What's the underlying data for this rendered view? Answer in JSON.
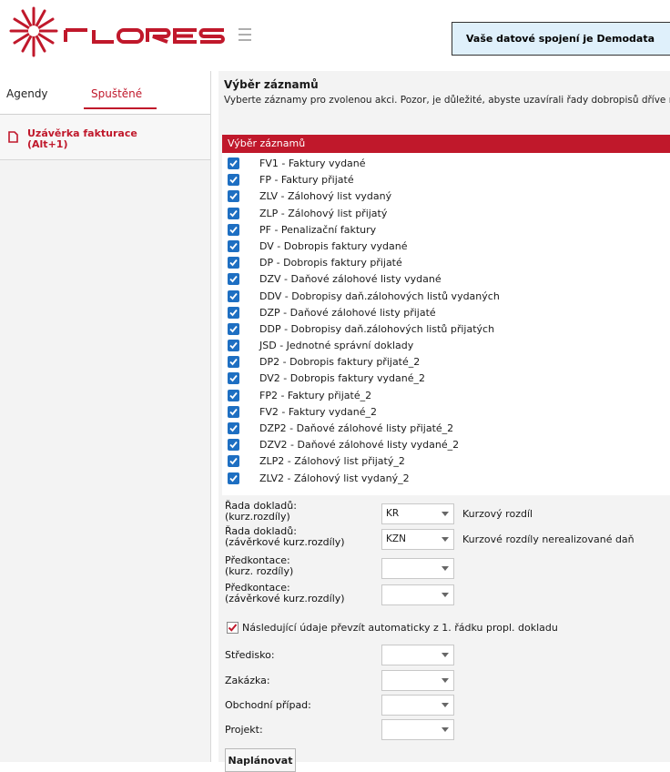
{
  "header": {
    "connection_text": "Vaše datové spojení je Demodata"
  },
  "colors": {
    "accent": "#c0182b",
    "checkbox": "#1e6fc2"
  },
  "sidebar": {
    "tabs": [
      {
        "label": "Agendy"
      },
      {
        "label": "Spuštěné",
        "active": true
      }
    ],
    "items": [
      {
        "label_line1": "Uzávěrka fakturace",
        "label_line2": "(Alt+1)",
        "icon": "document-icon"
      }
    ]
  },
  "main": {
    "title": "Výběr záznamů",
    "description": "Vyberte záznamy pro zvolenou akci. Pozor, je důležité, abyste uzavírali řady dobropisů dříve ne",
    "list_header": "Výběr záznamů",
    "records": [
      {
        "label": "FV1 - Faktury vydané",
        "checked": true
      },
      {
        "label": "FP - Faktury přijaté",
        "checked": true
      },
      {
        "label": "ZLV - Zálohový list vydaný",
        "checked": true
      },
      {
        "label": "ZLP - Zálohový list přijatý",
        "checked": true
      },
      {
        "label": "PF - Penalizační faktury",
        "checked": true
      },
      {
        "label": "DV - Dobropis faktury vydané",
        "checked": true
      },
      {
        "label": "DP - Dobropis faktury přijaté",
        "checked": true
      },
      {
        "label": "DZV - Daňové zálohové listy vydané",
        "checked": true
      },
      {
        "label": "DDV - Dobropisy daň.zálohových listů vydaných",
        "checked": true
      },
      {
        "label": "DZP - Daňové zálohové listy přijaté",
        "checked": true
      },
      {
        "label": "DDP - Dobropisy daň.zálohových listů přijatých",
        "checked": true
      },
      {
        "label": "JSD - Jednotné správní doklady",
        "checked": true
      },
      {
        "label": "DP2 - Dobropis faktury přijaté_2",
        "checked": true
      },
      {
        "label": "DV2 - Dobropis faktury vydané_2",
        "checked": true
      },
      {
        "label": "FP2 - Faktury přijaté_2",
        "checked": true
      },
      {
        "label": "FV2 - Faktury vydané_2",
        "checked": true
      },
      {
        "label": "DZP2 - Daňové zálohové listy přijaté_2",
        "checked": true
      },
      {
        "label": "DZV2 - Daňové zálohové listy vydané_2",
        "checked": true
      },
      {
        "label": "ZLP2 - Zálohový list přijatý_2",
        "checked": true
      },
      {
        "label": "ZLV2 - Zálohový list vydaný_2",
        "checked": true
      }
    ]
  },
  "form": {
    "rada_kurz": {
      "label1": "Řada dokladů:",
      "label2": "(kurz.rozdíly)",
      "value": "KR",
      "description": "Kurzový rozdíl"
    },
    "rada_zaverka": {
      "label1": "Řada dokladů:",
      "label2": "(závěrkové kurz.rozdíly)",
      "value": "KZN",
      "description": "Kurzové rozdíly nerealizované daň"
    },
    "predkontace_kurz": {
      "label1": "Předkontace:",
      "label2": "(kurz. rozdíly)",
      "value": ""
    },
    "predkontace_zaverka": {
      "label1": "Předkontace:",
      "label2": "(závěrkové kurz.rozdíly)",
      "value": ""
    },
    "auto_copy": {
      "label": "Následující údaje převzít automaticky z 1. řádku propl. dokladu",
      "checked": true
    },
    "stredisko": {
      "label": "Středisko:",
      "value": ""
    },
    "zakazka": {
      "label": "Zakázka:",
      "value": ""
    },
    "obchodni_pripad": {
      "label": "Obchodní případ:",
      "value": ""
    },
    "projekt": {
      "label": "Projekt:",
      "value": ""
    },
    "plan_button": "Naplánovat"
  }
}
